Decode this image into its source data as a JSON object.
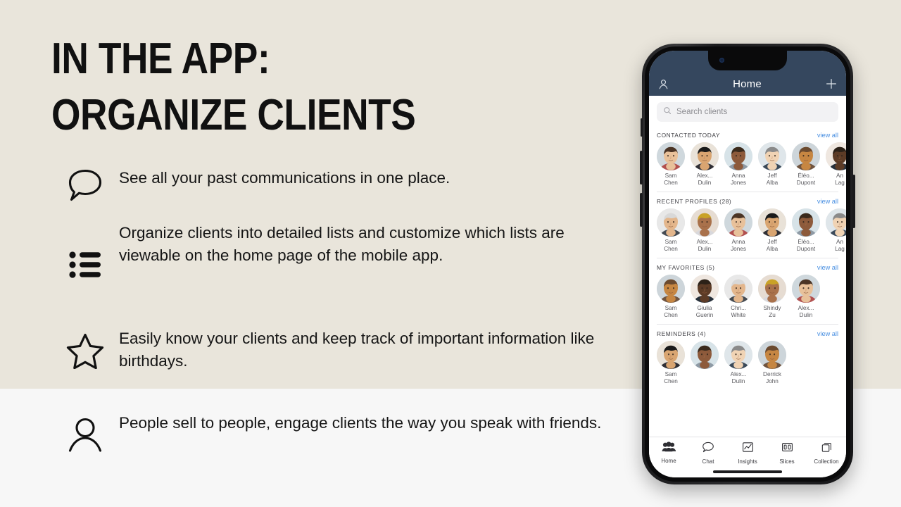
{
  "slide": {
    "title": "IN THE APP:\nORGANIZE CLIENTS",
    "bg_top_color": "#e9e5db",
    "bg_bottom_color": "#f7f7f7",
    "bullets": [
      {
        "icon": "speech-bubble-icon",
        "text": "See all your past communications in one place."
      },
      {
        "icon": "bulleted-list-icon",
        "text": "Organize clients into detailed lists and customize which lists are viewable on the home page of the mobile app."
      },
      {
        "icon": "star-icon",
        "text": "Easily know your clients and keep track of important information like birthdays."
      },
      {
        "icon": "person-icon",
        "text": "People sell to people, engage clients the way you speak with friends."
      }
    ]
  },
  "phone": {
    "accent_color": "#4a90e2",
    "header_color": "#35475e",
    "header": {
      "title": "Home",
      "left_icon": "profile-icon",
      "right_icon": "plus-icon"
    },
    "search": {
      "icon": "search-icon",
      "placeholder": "Search clients"
    },
    "sections": [
      {
        "title": "CONTACTED TODAY",
        "view_all": "view all",
        "contacts": [
          {
            "first": "Sam",
            "last": "Chen"
          },
          {
            "first": "Alex...",
            "last": "Dulin"
          },
          {
            "first": "Anna",
            "last": "Jones"
          },
          {
            "first": "Jeff",
            "last": "Alba"
          },
          {
            "first": "Éléo...",
            "last": "Dupont"
          },
          {
            "first": "An",
            "last": "Lag"
          }
        ]
      },
      {
        "title": "RECENT PROFILES (28)",
        "view_all": "view all",
        "contacts": [
          {
            "first": "Sam",
            "last": "Chen"
          },
          {
            "first": "Alex...",
            "last": "Dulin"
          },
          {
            "first": "Anna",
            "last": "Jones"
          },
          {
            "first": "Jeff",
            "last": "Alba"
          },
          {
            "first": "Éléo...",
            "last": "Dupont"
          },
          {
            "first": "An",
            "last": "Lag"
          }
        ]
      },
      {
        "title": "MY FAVORITES (5)",
        "view_all": "view all",
        "contacts": [
          {
            "first": "Sam",
            "last": "Chen"
          },
          {
            "first": "Giulia",
            "last": "Guerin"
          },
          {
            "first": "Chri...",
            "last": "White"
          },
          {
            "first": "Shindy",
            "last": "Zu"
          },
          {
            "first": "Alex...",
            "last": "Dulin"
          }
        ]
      },
      {
        "title": "REMINDERS (4)",
        "view_all": "view all",
        "contacts": [
          {
            "first": "Sam",
            "last": "Chen"
          },
          {
            "first": "",
            "last": ""
          },
          {
            "first": "Alex...",
            "last": "Dulin"
          },
          {
            "first": "Derrick",
            "last": "John"
          }
        ]
      }
    ],
    "tabs": [
      {
        "label": "Home",
        "icon": "people-icon",
        "active": true
      },
      {
        "label": "Chat",
        "icon": "chat-icon",
        "active": false
      },
      {
        "label": "Insights",
        "icon": "chart-icon",
        "active": false
      },
      {
        "label": "Slices",
        "icon": "slices-icon",
        "active": false
      },
      {
        "label": "Collection",
        "icon": "stack-icon",
        "active": false
      }
    ]
  }
}
